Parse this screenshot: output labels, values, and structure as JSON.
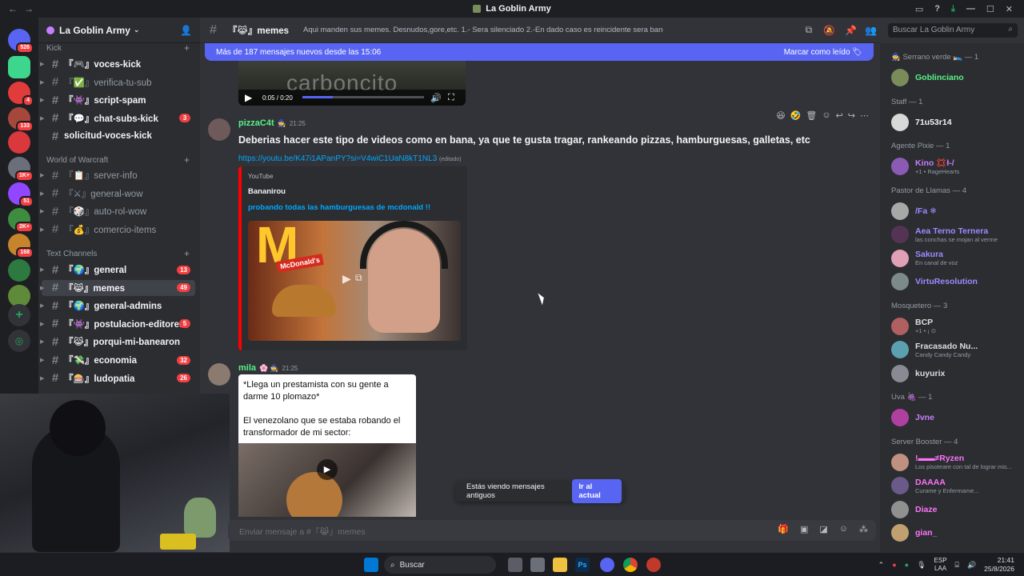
{
  "window": {
    "title": "La Goblin Army"
  },
  "guilds": [
    {
      "badge": "526",
      "color": "#5865f2"
    },
    {
      "badge": "",
      "color": "#3dd68c"
    },
    {
      "badge": "4",
      "color": "#e23b3b"
    },
    {
      "badge": "133",
      "color": "#a5473b"
    },
    {
      "badge": "",
      "color": "#d9383c"
    },
    {
      "badge": "1K+",
      "color": "#6b6f7b"
    },
    {
      "badge": "51",
      "color": "#9146ff"
    },
    {
      "badge": "2K+",
      "color": "#3d8c40"
    },
    {
      "badge": "168",
      "color": "#c7852b"
    },
    {
      "badge": "",
      "color": "#2c7a3f"
    },
    {
      "badge": "",
      "color": "#5f8a3a"
    }
  ],
  "server": {
    "name": "La Goblin Army"
  },
  "categories": {
    "kick": "Kick",
    "wow": "World of Warcraft",
    "text": "Text Channels"
  },
  "channels_kick": [
    {
      "name": "『🎮』voces-kick",
      "badge": ""
    },
    {
      "name": "『✅』verifica-tu-sub",
      "badge": ""
    },
    {
      "name": "『👾』script-spam",
      "badge": ""
    },
    {
      "name": "『💬』chat-subs-kick",
      "badge": "3"
    },
    {
      "name": "solicitud-voces-kick",
      "badge": ""
    }
  ],
  "channels_wow": [
    {
      "name": "『📋』server-info"
    },
    {
      "name": "『⚔』general-wow"
    },
    {
      "name": "『🎲』auto-rol-wow"
    },
    {
      "name": "『💰』comercio-items"
    }
  ],
  "channels_text": [
    {
      "name": "『🌍』general",
      "badge": "13"
    },
    {
      "name": "『😹』memes",
      "badge": "49"
    },
    {
      "name": "『🌍』general-admins",
      "badge": ""
    },
    {
      "name": "『👾』postulacion-editores",
      "badge": "5"
    },
    {
      "name": "『😹』porqui-mi-banearon",
      "badge": ""
    },
    {
      "name": "『💸』economia",
      "badge": "32"
    },
    {
      "name": "『🎰』ludopatia",
      "badge": "26"
    }
  ],
  "chat": {
    "channel": "『😹』memes",
    "topic": "Aqui manden sus memes. Desnudos,gore,etc. 1.- Sera silenciado 2.-En dado caso es reincidente sera baneado",
    "search_placeholder": "Buscar La Goblin Army",
    "new_messages": "Más de 187 mensajes nuevos desde las 15:06",
    "mark_read": "Marcar como leído",
    "input_placeholder": "Enviar mensaje a #『😹』memes"
  },
  "video_player": {
    "time": "0:05 / 0:20",
    "overlay": "carboncito",
    "progress": 0.25
  },
  "messages": [
    {
      "author": "pizzaC4t",
      "time": "21:25",
      "text": "Deberias hacer este tipo de videos como en bana, ya que te gusta tragar, rankeando pizzas, hamburguesas, galletas, etc",
      "link": "https://youtu.be/K47i1APanPY?si=V4wiC1UaN8kT1NL3",
      "edited": "(editado)",
      "embed": {
        "provider": "YouTube",
        "author": "Bananirou",
        "title": "probando todas las hamburguesas de mcdonald !!",
        "thumb_text": "McDonald's"
      }
    },
    {
      "author": "mila",
      "time": "21:25",
      "meme_text": "*Llega un prestamista con su gente a darme 10 plomazo*\n\nEl venezolano que se estaba robando el transformador de mi sector:"
    }
  ],
  "old_messages": {
    "text": "Estás viendo mensajes antiguos",
    "button": "Ir al actual"
  },
  "members": [
    {
      "type": "cat",
      "label": "🧙 Serrano verde 🛌 — 1"
    },
    {
      "type": "mem",
      "name": "Goblinciano",
      "sub": "",
      "color": "#57f287",
      "av": "#7a8c5a"
    },
    {
      "type": "cat",
      "label": "Staff — 1"
    },
    {
      "type": "mem",
      "name": "71u53r14",
      "sub": "",
      "color": "#f2f3f5",
      "av": "#d8d8d8"
    },
    {
      "type": "cat",
      "label": "Agente Pixie — 1"
    },
    {
      "type": "mem",
      "name": "Kino 💢ł-/",
      "sub": "+1 • RageHearts",
      "color": "#c77dff",
      "av": "#8a5ab5"
    },
    {
      "type": "cat",
      "label": "Pastor de Llamas — 4"
    },
    {
      "type": "mem",
      "name": "/Fa ❄",
      "sub": "",
      "color": "#9b8cff",
      "av": "#a8a8a8"
    },
    {
      "type": "mem",
      "name": "Aea Terno Ternera",
      "sub": "las conchas se mojan al verme",
      "color": "#9b8cff",
      "av": "#553355"
    },
    {
      "type": "mem",
      "name": "Sakura",
      "sub": "En canal de voz",
      "color": "#9b8cff",
      "av": "#e0a0b5"
    },
    {
      "type": "mem",
      "name": "VirtuResolution",
      "sub": "",
      "color": "#9b8cff",
      "av": "#7d8a8a"
    },
    {
      "type": "cat",
      "label": "Mosquetero — 3"
    },
    {
      "type": "mem",
      "name": "BCP",
      "sub": "+1 • ¡ ⊙",
      "color": "#dbdee1",
      "av": "#b06060"
    },
    {
      "type": "mem",
      "name": "Fracasado Nu...",
      "sub": "Candy Candy Candy",
      "color": "#dbdee1",
      "av": "#5aa0b0"
    },
    {
      "type": "mem",
      "name": "kuyurix",
      "sub": "",
      "color": "#dbdee1",
      "av": "#8a8a95"
    },
    {
      "type": "cat",
      "label": "Uva 🍇 — 1"
    },
    {
      "type": "mem",
      "name": "Jvne",
      "sub": "",
      "color": "#c77dff",
      "av": "#b040a0"
    },
    {
      "type": "cat",
      "label": "Server Booster — 4"
    },
    {
      "type": "mem",
      "name": "!▬▬≠Ryzen",
      "sub": "Los pisoteare con tal de lograr mis...",
      "color": "#ff73fa",
      "av": "#c09080"
    },
    {
      "type": "mem",
      "name": "DAAAA",
      "sub": "Curame y Enfermame...",
      "color": "#ff73fa",
      "av": "#6a5a8a"
    },
    {
      "type": "mem",
      "name": "Diaze",
      "sub": "",
      "color": "#ff73fa",
      "av": "#909090"
    },
    {
      "type": "mem",
      "name": "gian_",
      "sub": "",
      "color": "#ff73fa",
      "av": "#c0a070"
    }
  ],
  "taskbar": {
    "search": "Buscar",
    "lang": "ESP",
    "lang2": "LAA",
    "time": "21:41",
    "date": "25/8/2026"
  }
}
